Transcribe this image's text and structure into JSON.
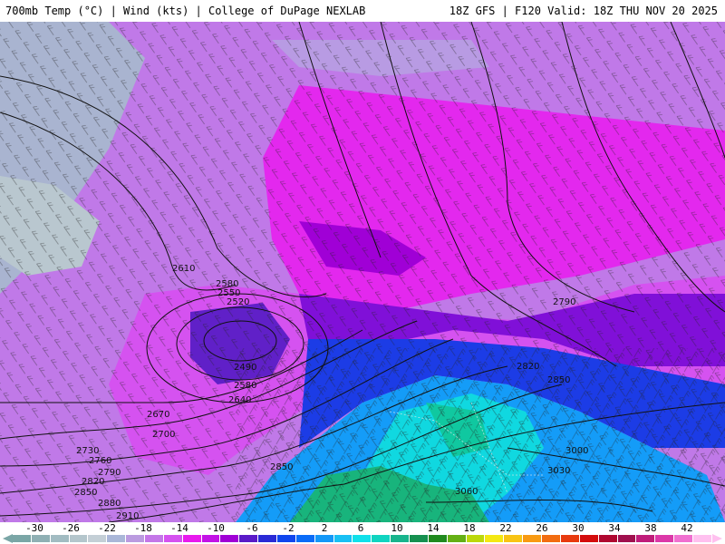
{
  "header": {
    "left_text": "700mb Temp (°C) | Wind (kts) | College of DuPage NEXLAB",
    "right_text": "18Z GFS | F120 Valid: 18Z THU NOV 20 2025"
  },
  "colorbar": {
    "ticks": [
      "-30",
      "-26",
      "-22",
      "-18",
      "-14",
      "-10",
      "-6",
      "-2",
      "2",
      "6",
      "10",
      "14",
      "18",
      "22",
      "26",
      "30",
      "34",
      "38",
      "42"
    ],
    "colors": [
      "#7aa6a6",
      "#8fb0b4",
      "#a2bcc2",
      "#b4c6cc",
      "#c4cfd6",
      "#aab7d8",
      "#bb9be0",
      "#c477e8",
      "#d552f0",
      "#e81aee",
      "#c312e6",
      "#a000d6",
      "#5a1ac8",
      "#2a2ad6",
      "#1046ee",
      "#0a6cf8",
      "#1498f8",
      "#18c0f4",
      "#10e0ea",
      "#10d4c0",
      "#18b48c",
      "#169050",
      "#208a1e",
      "#64b014",
      "#bcd80a",
      "#f4e812",
      "#f8c414",
      "#f89a12",
      "#f26c10",
      "#e83a0e",
      "#d40c0c",
      "#b00830",
      "#a0104e",
      "#c01c7a",
      "#dc38a8",
      "#f070d0",
      "#ffc0ef"
    ]
  },
  "contours": {
    "labels": [
      {
        "text": "2610"
      },
      {
        "text": "2580"
      },
      {
        "text": "2550"
      },
      {
        "text": "2520"
      },
      {
        "text": "2490"
      },
      {
        "text": "2580"
      },
      {
        "text": "2640"
      },
      {
        "text": "2670"
      },
      {
        "text": "2700"
      },
      {
        "text": "2730"
      },
      {
        "text": "2760"
      },
      {
        "text": "2790"
      },
      {
        "text": "2820"
      },
      {
        "text": "2850"
      },
      {
        "text": "2880"
      },
      {
        "text": "2910"
      },
      {
        "text": "2850"
      },
      {
        "text": "2790"
      },
      {
        "text": "2820"
      },
      {
        "text": "2850"
      },
      {
        "text": "3000"
      },
      {
        "text": "3030"
      },
      {
        "text": "3060"
      }
    ]
  }
}
